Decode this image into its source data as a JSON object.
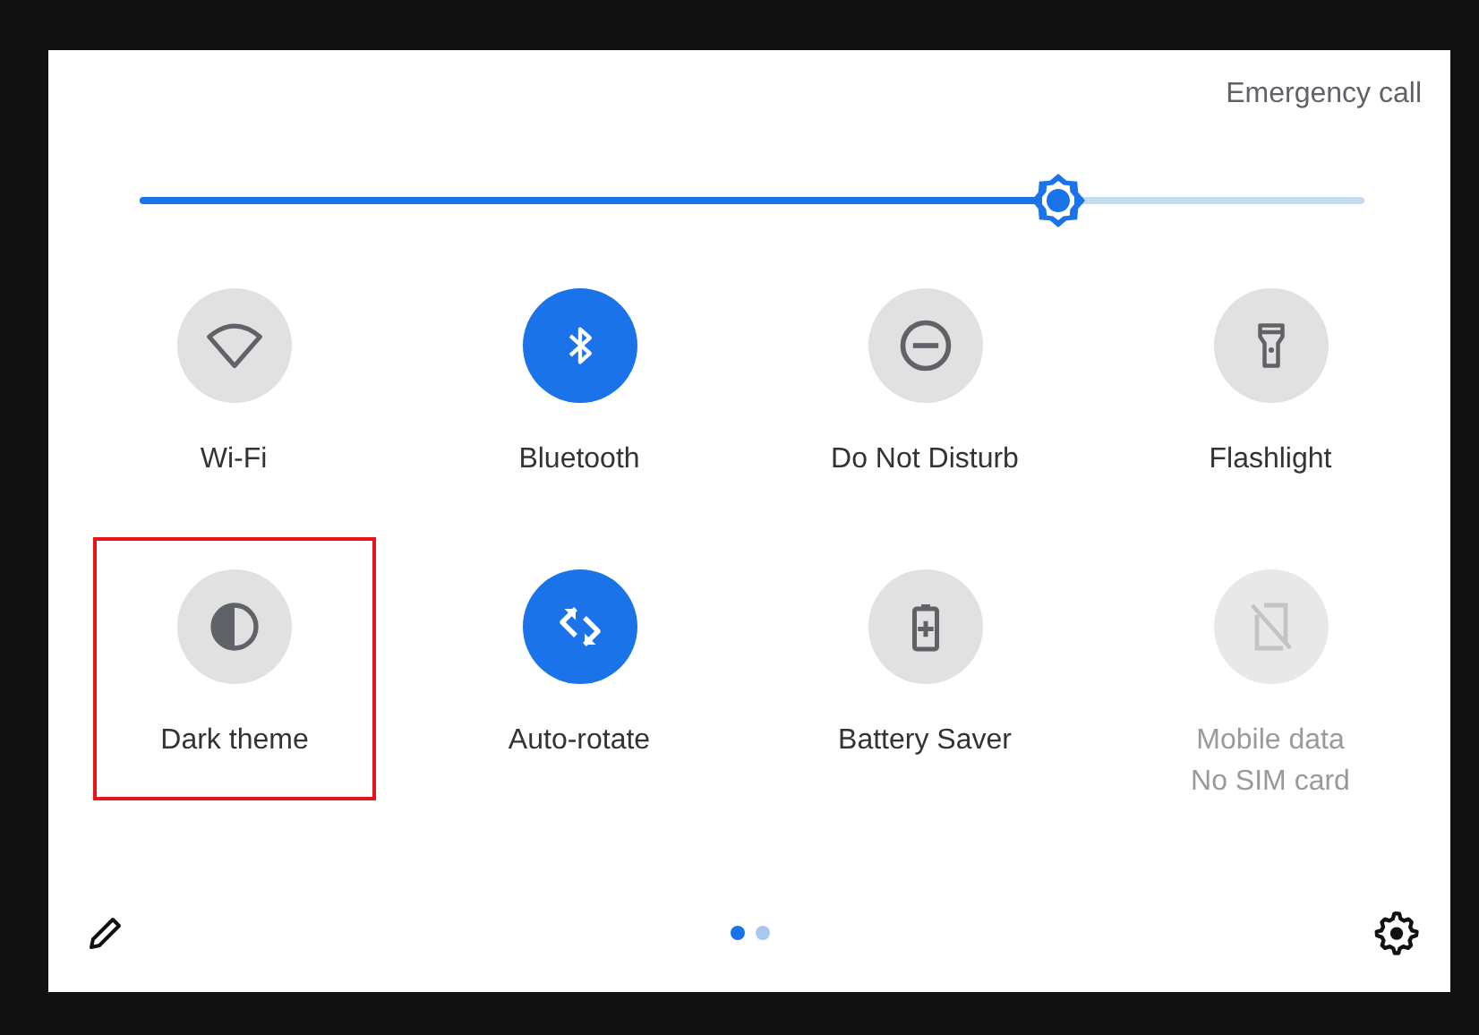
{
  "emergency_call": "Emergency call",
  "brightness": {
    "level": 0.75
  },
  "tiles": [
    {
      "kind": "wifi",
      "label": "Wi-Fi",
      "on": false,
      "disabled": false,
      "highlighted": false
    },
    {
      "kind": "bluetooth",
      "label": "Bluetooth",
      "on": true,
      "disabled": false,
      "highlighted": false
    },
    {
      "kind": "dnd",
      "label": "Do Not Disturb",
      "on": false,
      "disabled": false,
      "highlighted": false
    },
    {
      "kind": "flashlight",
      "label": "Flashlight",
      "on": false,
      "disabled": false,
      "highlighted": false
    },
    {
      "kind": "theme",
      "label": "Dark theme",
      "on": false,
      "disabled": false,
      "highlighted": true
    },
    {
      "kind": "rotate",
      "label": "Auto-rotate",
      "on": true,
      "disabled": false,
      "highlighted": false
    },
    {
      "kind": "battery",
      "label": "Battery Saver",
      "on": false,
      "disabled": false,
      "highlighted": false
    },
    {
      "kind": "mobile",
      "label": "Mobile data",
      "sublabel": "No SIM card",
      "on": false,
      "disabled": true,
      "highlighted": false
    }
  ],
  "pages": [
    {
      "selected": true
    },
    {
      "selected": false
    }
  ]
}
